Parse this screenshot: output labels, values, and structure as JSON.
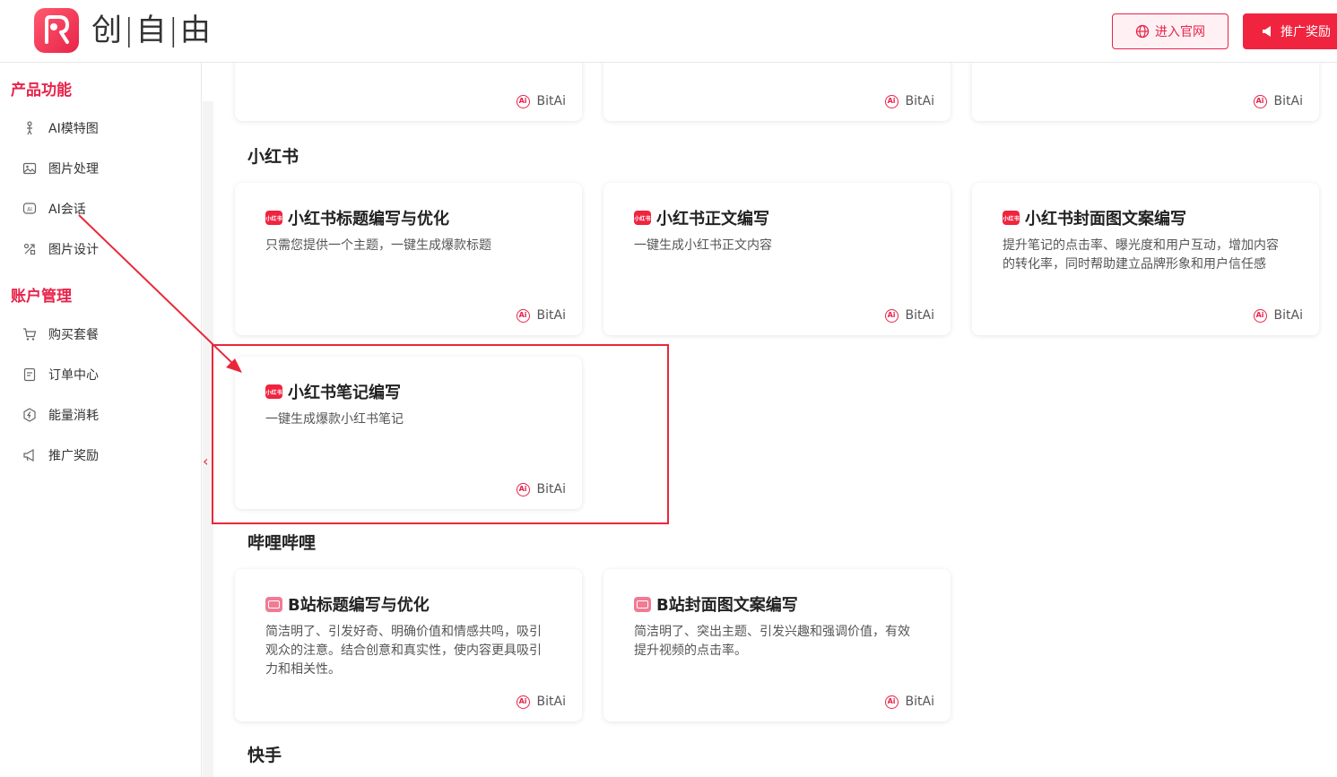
{
  "header": {
    "brand": "创|自|由",
    "site_button": "进入官网",
    "promo_button": "推广奖励"
  },
  "sidebar": {
    "section_product": "产品功能",
    "section_account": "账户管理",
    "product_items": [
      {
        "label": "AI模特图",
        "icon": "model-icon"
      },
      {
        "label": "图片处理",
        "icon": "image-icon"
      },
      {
        "label": "AI会话",
        "icon": "ai-chat-icon"
      },
      {
        "label": "图片设计",
        "icon": "design-icon"
      }
    ],
    "account_items": [
      {
        "label": "购买套餐",
        "icon": "cart-icon"
      },
      {
        "label": "订单中心",
        "icon": "order-icon"
      },
      {
        "label": "能量消耗",
        "icon": "energy-icon"
      },
      {
        "label": "推广奖励",
        "icon": "megaphone-icon"
      }
    ]
  },
  "main": {
    "card_brand": "BitAi",
    "groups": {
      "xhs": "小红书",
      "bili": "哔哩哔哩",
      "ks": "快手"
    },
    "xhs_badge": "小红书",
    "xhs_cards": [
      {
        "title": "小红书标题编写与优化",
        "desc": "只需您提供一个主题，一键生成爆款标题"
      },
      {
        "title": "小红书正文编写",
        "desc": "一键生成小红书正文内容"
      },
      {
        "title": "小红书封面图文案编写",
        "desc": "提升笔记的点击率、曝光度和用户互动，增加内容的转化率，同时帮助建立品牌形象和用户信任感"
      },
      {
        "title": "小红书笔记编写",
        "desc": "一键生成爆款小红书笔记"
      }
    ],
    "bili_cards": [
      {
        "title": "B站标题编写与优化",
        "desc": "简洁明了、引发好奇、明确价值和情感共鸣，吸引观众的注意。结合创意和真实性，使内容更具吸引力和相关性。"
      },
      {
        "title": "B站封面图文案编写",
        "desc": "简洁明了、突出主题、引发兴趣和强调价值，有效提升视频的点击率。"
      }
    ]
  },
  "colors": {
    "accent": "#e8234a",
    "annotation": "#e8283a"
  }
}
